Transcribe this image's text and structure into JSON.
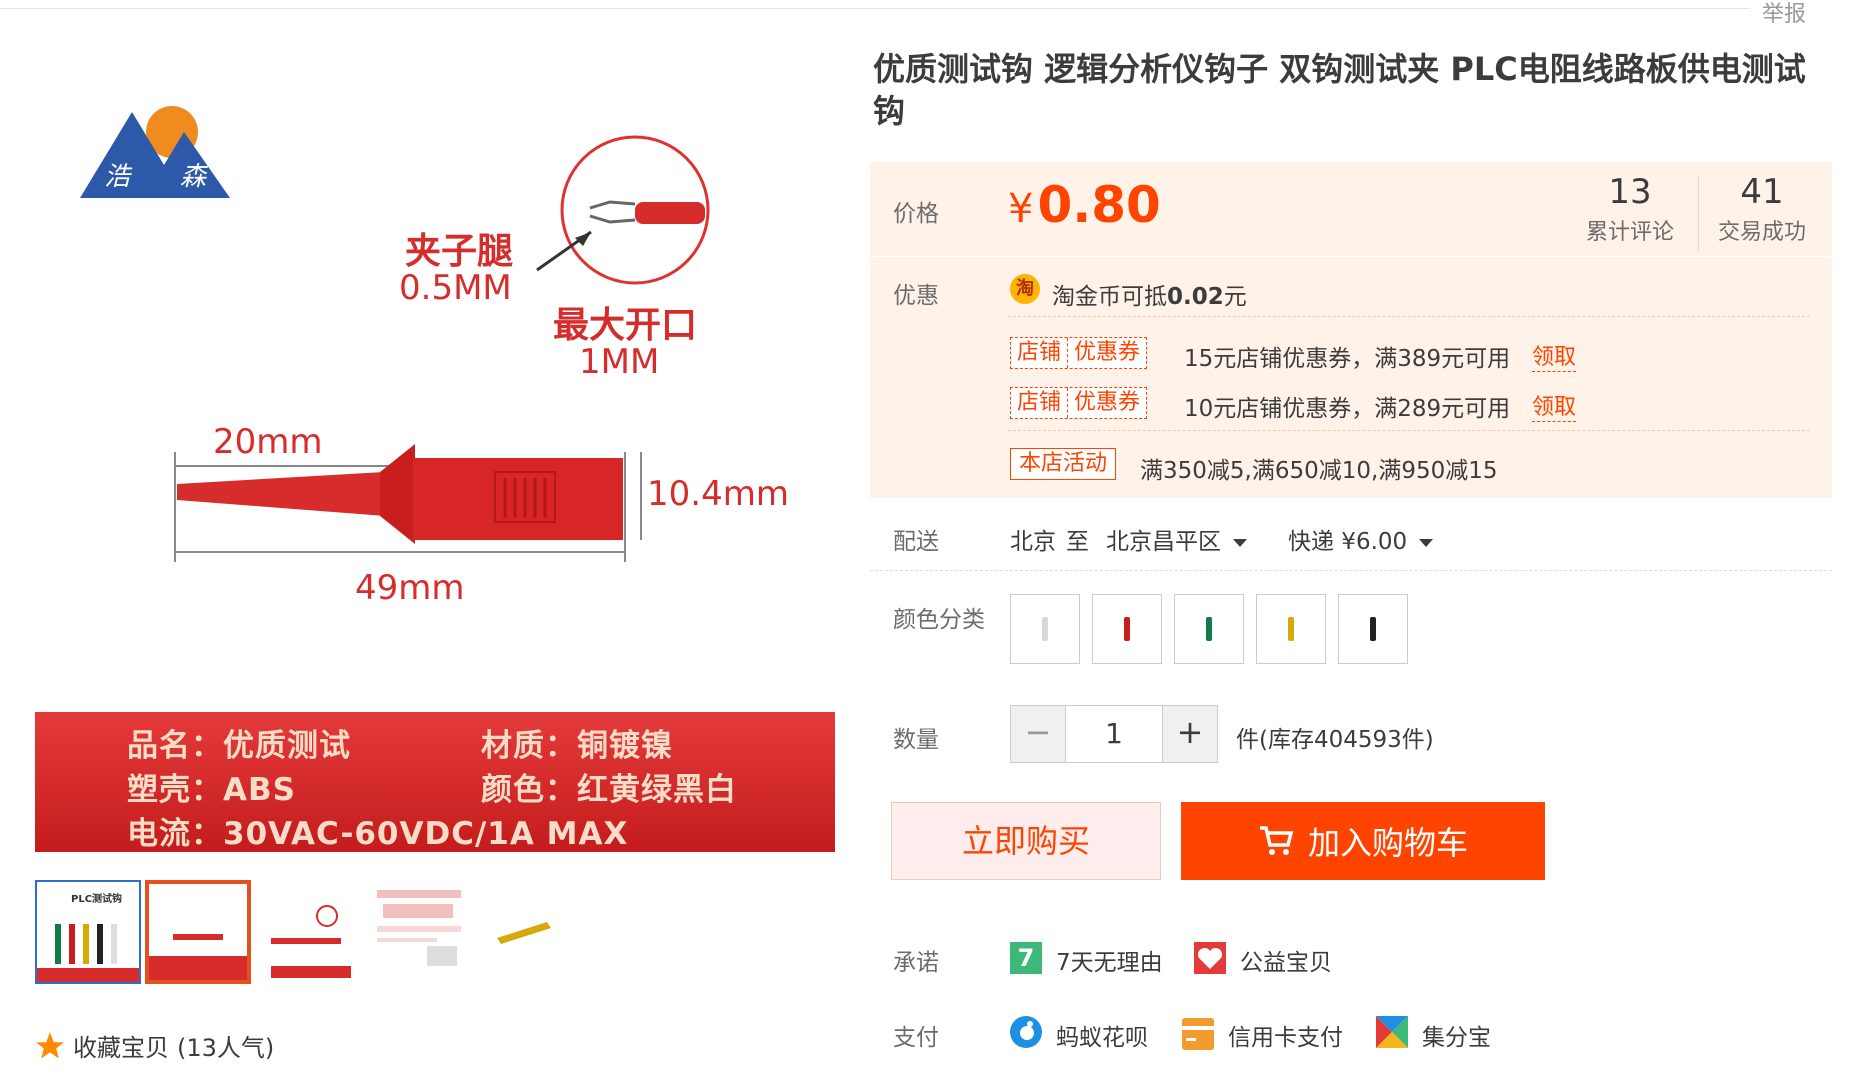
{
  "header": {
    "report_label": "举报"
  },
  "gallery": {
    "brand_chars": [
      "浩",
      "森"
    ],
    "annotations": {
      "leg_label": "夹子腿",
      "leg_size": "0.5MM",
      "opening_label": "最大开口",
      "opening_size": "1MM",
      "dim_tip": "20mm",
      "dim_height": "10.4mm",
      "dim_total": "49mm"
    },
    "specs": {
      "name": "品名：优质测试",
      "material": "材质：铜镀镍",
      "shell": "塑壳：ABS",
      "color": "颜色：红黄绿黑白",
      "current": "电流：30VAC-60VDC/1A MAX"
    },
    "thumbnails": [
      {
        "label": "PLC测试钩",
        "active": false
      },
      {
        "label": "",
        "active": true
      },
      {
        "label": "",
        "active": false
      },
      {
        "label": "",
        "active": false
      },
      {
        "label": "",
        "active": false
      }
    ],
    "collect": {
      "label": "收藏宝贝",
      "count_text": "(13人气)"
    }
  },
  "product": {
    "title_line1": "优质测试钩 逻辑分析仪钩子 双钩测试夹 PLC电阻线路板供电测试",
    "title_line2": "钩"
  },
  "price": {
    "label": "价格",
    "currency": "¥",
    "value": "0.80",
    "reviews": {
      "count": "13",
      "label": "累计评论"
    },
    "deals": {
      "count": "41",
      "label": "交易成功"
    }
  },
  "promo": {
    "label": "优惠",
    "coin_icon": "淘",
    "coin_text_prefix": "淘金币可抵",
    "coin_amount": "0.02",
    "coin_unit": "元",
    "coupons": [
      {
        "tag_left": "店铺",
        "tag_right": "优惠券",
        "text": "15元店铺优惠券，满389元可用",
        "action": "领取"
      },
      {
        "tag_left": "店铺",
        "tag_right": "优惠券",
        "text": "10元店铺优惠券，满289元可用",
        "action": "领取"
      }
    ],
    "activity_tag": "本店活动",
    "activity_text": "满350减5,满650减10,满950减15"
  },
  "delivery": {
    "label": "配送",
    "from": "北京",
    "to_word": "至",
    "to": "北京昌平区",
    "method": "快递 ¥6.00"
  },
  "colors": {
    "label": "颜色分类",
    "swatches": [
      {
        "name": "white",
        "color": "#d9d9d9"
      },
      {
        "name": "red",
        "color": "#c81e1e"
      },
      {
        "name": "green",
        "color": "#137a4a"
      },
      {
        "name": "yellow",
        "color": "#d6a90b"
      },
      {
        "name": "black",
        "color": "#222222"
      }
    ]
  },
  "quantity": {
    "label": "数量",
    "value": "1",
    "minus": "−",
    "plus": "+",
    "stock_text": "件(库存404593件)"
  },
  "actions": {
    "buy_now": "立即购买",
    "add_to_cart": "加入购物车"
  },
  "promise": {
    "label": "承诺",
    "items": [
      {
        "icon": "7",
        "text": "7天无理由"
      },
      {
        "icon": "heart",
        "text": "公益宝贝"
      }
    ]
  },
  "payment": {
    "label": "支付",
    "items": [
      {
        "icon": "huabei",
        "text": "蚂蚁花呗"
      },
      {
        "icon": "card",
        "text": "信用卡支付"
      },
      {
        "icon": "jifen",
        "text": "集分宝"
      }
    ]
  },
  "theme": {
    "accent": "#ff4400",
    "price_bg": "#fff2e8"
  }
}
